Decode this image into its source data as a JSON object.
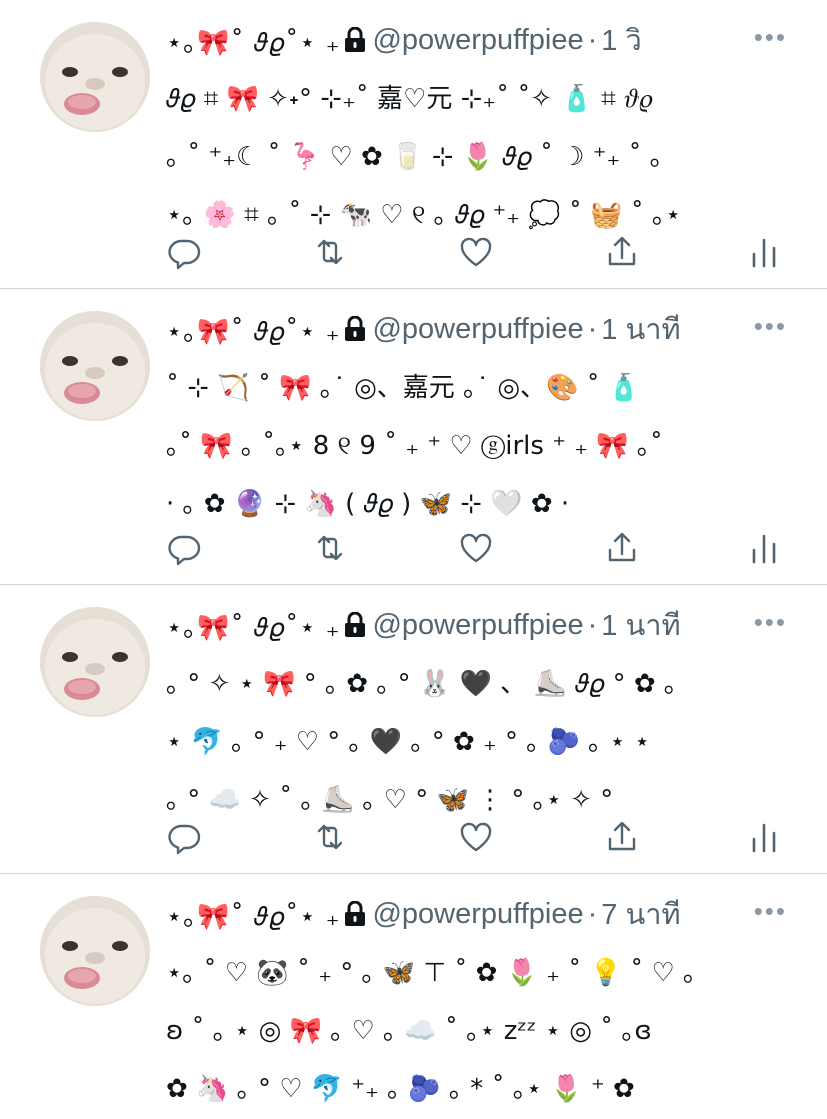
{
  "display_name": "⋆｡🎀˚ 𝜗𝜚˚⋆ ₊",
  "handle": "@powerpuffpiee",
  "separator": "·",
  "more_label": "•••",
  "tweets": [
    {
      "time": "1 วิ",
      "lines": [
        "𝜗𝜚 ⌗ 🎀 ✧˖° ⊹₊˚ 嘉♡元 ⊹₊˚ ˚✧ 🧴 ⌗ 𝜗𝜚",
        "｡ ˚ ⁺₊☾ ˚ 🦩 ♡ ✿ 🥛 ⊹ 🌷 𝜗𝜚 ˚ ☽ ⁺₊ ˚ ｡",
        "⋆｡ 🌸 ⌗ ｡ ˚ ⊹ 🐄 ♡ ୧ ｡ 𝜗𝜚 ⁺₊ 💭 ˚ 🧺 ˚ ｡⋆"
      ]
    },
    {
      "time": "1 นาที",
      "lines": [
        "˚ ⊹ 🏹 ˚ 🎀 ｡˙ ◎、嘉元 ｡˙ ◎、🎨 ˚ 🧴",
        "｡˚ 🎀 ｡ ˚｡⋆ 8 ୧ 9 ˚ ₊ ⁺ ♡ ⓖirls ⁺ ₊ 🎀 ｡˚",
        "· ｡ ✿ 🔮 ⊹ 🦄 ( 𝜗𝜚 ) 🦋 ⊹ 🤍 ✿ ·"
      ]
    },
    {
      "time": "1 นาที",
      "lines": [
        "｡ ° ✧ ⋆ 🎀 ° ｡ ✿ ｡ ° 🐰 🖤 、 ⛸️ 𝜗𝜚 ° ✿ ｡",
        "⋆ 🐬 ｡ ° ₊ ♡ ° ｡ 🖤 ｡ ° ✿ ₊ ° ｡ 🫐 ｡ ⋆ ⋆",
        "｡ ° ☁️ ✧ ˚ ｡ ⛸️ ｡ ♡ ° 🦋 ⋮ ° ｡⋆ ✧ °"
      ]
    },
    {
      "time": "7 นาที",
      "lines": [
        "⋆｡ ˚ ♡ 🐼 ˚ ₊ ° ｡ 🦋 ⊤ ˚ ✿ 🌷 ₊ ˚ 💡 ˚ ♡ ｡",
        "ʚ ˚ ｡ ⋆ ◎ 🎀 ｡ ♡ ｡ ☁️ ˚ ｡⋆ zᶻᶻ ⋆ ◎ ˚ ｡ɞ",
        "✿ 🦄 ｡ ° ♡ 🐬 ⁺₊ ｡ 🫐 ｡ * ˚ ｡⋆ 🌷 ⁺ ✿"
      ]
    }
  ],
  "colors": {
    "handle_gray": "#536471",
    "divider": "#cfd4d8",
    "icon_gray": "#536471"
  },
  "icons": {
    "reply": "reply-icon",
    "retweet": "retweet-icon",
    "like": "heart-icon",
    "share": "share-icon",
    "stats": "stats-icon",
    "lock": "lock-icon",
    "avatar": "avatar-image"
  }
}
